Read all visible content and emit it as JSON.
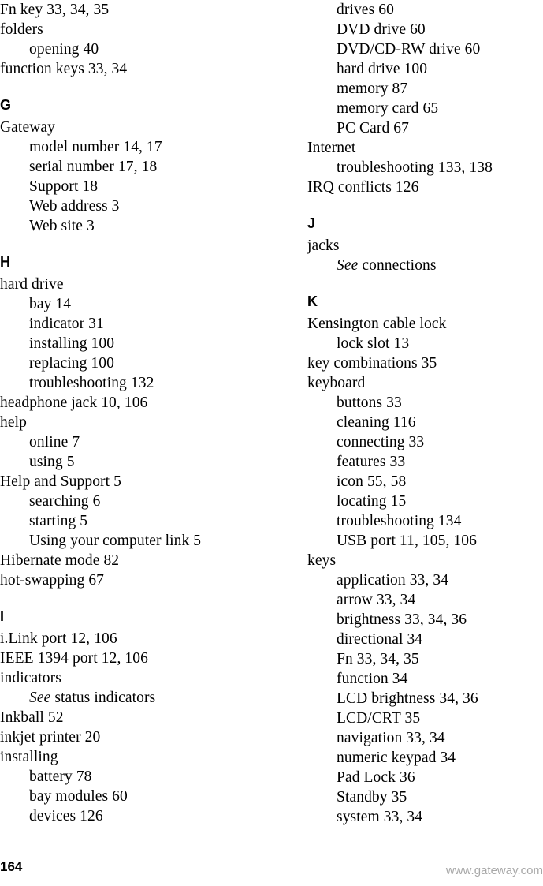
{
  "document": {
    "type": "index",
    "page_number": "164",
    "footer_url": "www.gateway.com",
    "footer_url_color": "#a8a8a8"
  },
  "columns": {
    "left": {
      "blocks": [
        {
          "heading": null,
          "entries": [
            {
              "level": 1,
              "text": "Fn key  33, 34, 35"
            },
            {
              "level": 1,
              "text": "folders"
            },
            {
              "level": 2,
              "text": "opening  40"
            },
            {
              "level": 1,
              "text": "function keys  33, 34"
            }
          ]
        },
        {
          "heading": "G",
          "entries": [
            {
              "level": 1,
              "text": "Gateway"
            },
            {
              "level": 2,
              "text": "model number  14, 17"
            },
            {
              "level": 2,
              "text": "serial number  17, 18"
            },
            {
              "level": 2,
              "text": "Support  18"
            },
            {
              "level": 2,
              "text": "Web address  3"
            },
            {
              "level": 2,
              "text": "Web site  3"
            }
          ]
        },
        {
          "heading": "H",
          "entries": [
            {
              "level": 1,
              "text": "hard drive"
            },
            {
              "level": 2,
              "text": "bay  14"
            },
            {
              "level": 2,
              "text": "indicator  31"
            },
            {
              "level": 2,
              "text": "installing  100"
            },
            {
              "level": 2,
              "text": "replacing  100"
            },
            {
              "level": 2,
              "text": "troubleshooting  132"
            },
            {
              "level": 1,
              "text": "headphone jack  10, 106"
            },
            {
              "level": 1,
              "text": "help"
            },
            {
              "level": 2,
              "text": "online  7"
            },
            {
              "level": 2,
              "text": "using  5"
            },
            {
              "level": 1,
              "text": "Help and Support  5"
            },
            {
              "level": 2,
              "text": "searching  6"
            },
            {
              "level": 2,
              "text": "starting  5"
            },
            {
              "level": 2,
              "text": "Using your computer link  5"
            },
            {
              "level": 1,
              "text": "Hibernate mode  82"
            },
            {
              "level": 1,
              "text": "hot-swapping  67"
            }
          ]
        },
        {
          "heading": "I",
          "entries": [
            {
              "level": 1,
              "text": "i.Link port  12, 106"
            },
            {
              "level": 1,
              "text": "IEEE 1394 port  12, 106"
            },
            {
              "level": 1,
              "text": "indicators"
            },
            {
              "level": 2,
              "see": "See",
              "text": " status indicators"
            },
            {
              "level": 1,
              "text": "Inkball  52"
            },
            {
              "level": 1,
              "text": "inkjet printer  20"
            },
            {
              "level": 1,
              "text": "installing"
            },
            {
              "level": 2,
              "text": "battery  78"
            },
            {
              "level": 2,
              "text": "bay modules  60"
            },
            {
              "level": 2,
              "text": "devices  126"
            }
          ]
        }
      ]
    },
    "right": {
      "blocks": [
        {
          "heading": null,
          "entries": [
            {
              "level": 2,
              "text": "drives  60"
            },
            {
              "level": 2,
              "text": "DVD drive  60"
            },
            {
              "level": 2,
              "text": "DVD/CD-RW drive  60"
            },
            {
              "level": 2,
              "text": "hard drive  100"
            },
            {
              "level": 2,
              "text": "memory  87"
            },
            {
              "level": 2,
              "text": "memory card  65"
            },
            {
              "level": 2,
              "text": "PC Card  67"
            },
            {
              "level": 1,
              "text": "Internet"
            },
            {
              "level": 2,
              "text": "troubleshooting  133, 138"
            },
            {
              "level": 1,
              "text": "IRQ conflicts  126"
            }
          ]
        },
        {
          "heading": "J",
          "entries": [
            {
              "level": 1,
              "text": "jacks"
            },
            {
              "level": 2,
              "see": "See",
              "text": " connections"
            }
          ]
        },
        {
          "heading": "K",
          "entries": [
            {
              "level": 1,
              "text": "Kensington cable lock"
            },
            {
              "level": 2,
              "text": "lock slot  13"
            },
            {
              "level": 1,
              "text": "key combinations  35"
            },
            {
              "level": 1,
              "text": "keyboard"
            },
            {
              "level": 2,
              "text": "buttons  33"
            },
            {
              "level": 2,
              "text": "cleaning  116"
            },
            {
              "level": 2,
              "text": "connecting  33"
            },
            {
              "level": 2,
              "text": "features  33"
            },
            {
              "level": 2,
              "text": "icon  55, 58"
            },
            {
              "level": 2,
              "text": "locating  15"
            },
            {
              "level": 2,
              "text": "troubleshooting  134"
            },
            {
              "level": 2,
              "text": "USB port  11, 105, 106"
            },
            {
              "level": 1,
              "text": "keys"
            },
            {
              "level": 2,
              "text": "application  33, 34"
            },
            {
              "level": 2,
              "text": "arrow  33, 34"
            },
            {
              "level": 2,
              "text": "brightness  33, 34, 36"
            },
            {
              "level": 2,
              "text": "directional  34"
            },
            {
              "level": 2,
              "text": "Fn  33, 34, 35"
            },
            {
              "level": 2,
              "text": "function  34"
            },
            {
              "level": 2,
              "text": "LCD brightness  34, 36"
            },
            {
              "level": 2,
              "text": "LCD/CRT  35"
            },
            {
              "level": 2,
              "text": "navigation  33, 34"
            },
            {
              "level": 2,
              "text": "numeric keypad  34"
            },
            {
              "level": 2,
              "text": "Pad Lock  36"
            },
            {
              "level": 2,
              "text": "Standby  35"
            },
            {
              "level": 2,
              "text": "system  33, 34"
            }
          ]
        }
      ]
    }
  }
}
